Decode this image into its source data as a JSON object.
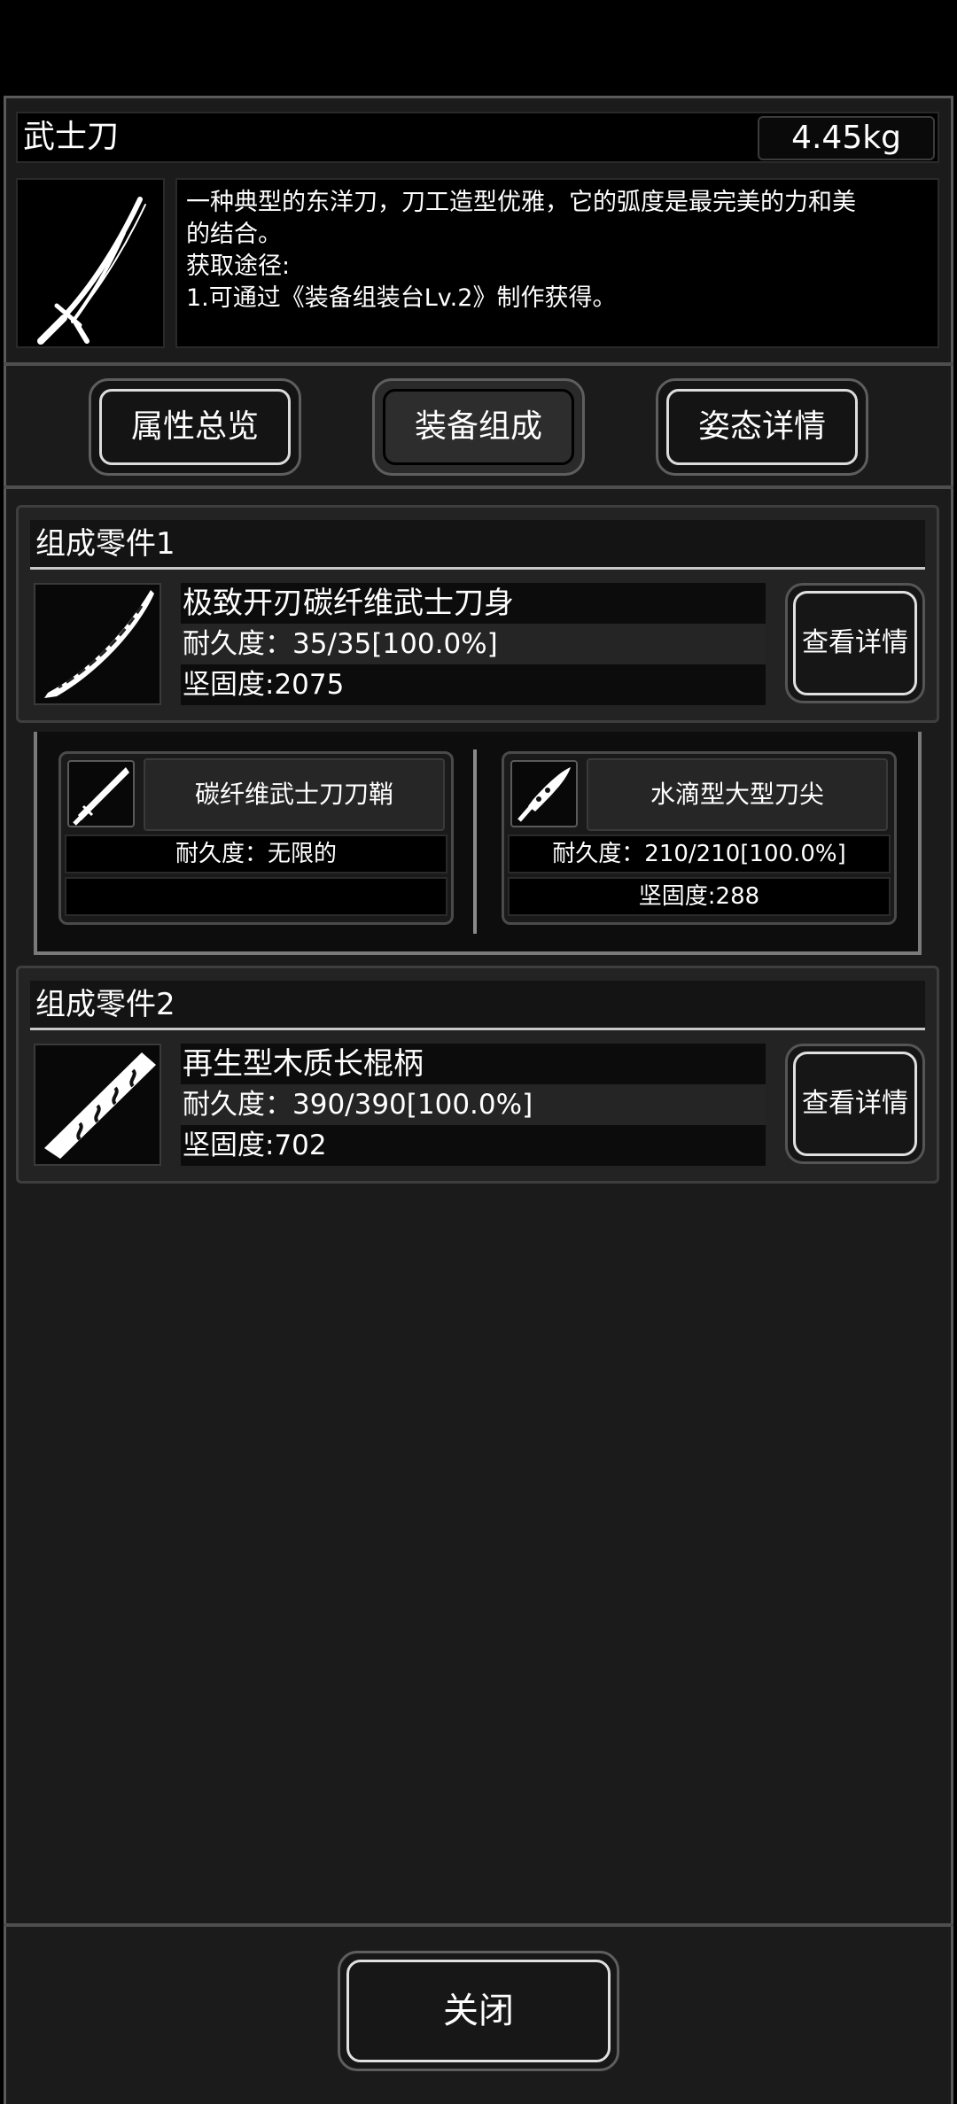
{
  "item": {
    "name": "武士刀",
    "weight": "4.45kg",
    "description": [
      "一种典型的东洋刀，刀工造型优雅，它的弧度是最完美的力和美",
      "的结合。",
      "获取途径:",
      "1.可通过《装备组装台Lv.2》制作获得。"
    ],
    "icon": "katana-icon"
  },
  "tabs": [
    {
      "label": "属性总览",
      "active": false
    },
    {
      "label": "装备组成",
      "active": true
    },
    {
      "label": "姿态详情",
      "active": false
    }
  ],
  "parts": [
    {
      "header": "组成零件1",
      "name": "极致开刃碳纤维武士刀身",
      "durability": "耐久度：35/35[100.0%]",
      "hardness": "坚固度:2075",
      "detail_label": "查看详情",
      "icon": "blade-icon"
    },
    {
      "header": "组成零件2",
      "name": "再生型木质长棍柄",
      "durability": "耐久度：390/390[100.0%]",
      "hardness": "坚固度:702",
      "detail_label": "查看详情",
      "icon": "wooden-handle-icon"
    }
  ],
  "subparts": [
    {
      "name": "碳纤维武士刀刀鞘",
      "durability": "耐久度：无限的",
      "hardness": "",
      "icon": "scabbard-icon"
    },
    {
      "name": "水滴型大型刀尖",
      "durability": "耐久度：210/210[100.0%]",
      "hardness": "坚固度:288",
      "icon": "blade-tip-icon"
    }
  ],
  "close_label": "关闭",
  "colors": {
    "panel_bg": "#1b1b1b",
    "border_gray": "#5a5a5a",
    "text": "#ffffff"
  }
}
